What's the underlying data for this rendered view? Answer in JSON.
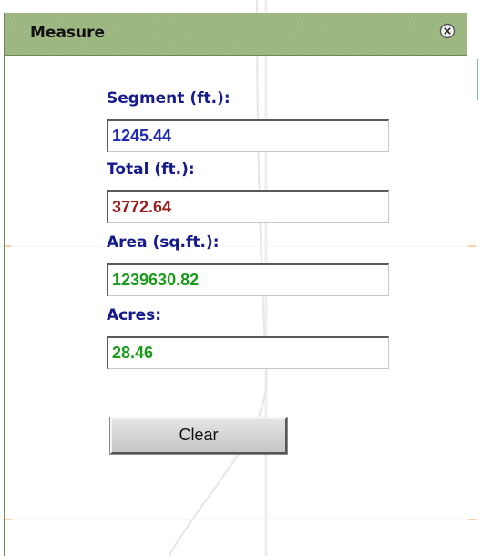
{
  "window": {
    "title": "Measure",
    "close_icon": "close-circle-icon"
  },
  "fields": {
    "segment": {
      "label": "Segment (ft.):",
      "value": "1245.44",
      "color": "#1f2bb0"
    },
    "total": {
      "label": "Total (ft.):",
      "value": "3772.64",
      "color": "#9a1a1a"
    },
    "area": {
      "label": "Area (sq.ft.):",
      "value": "1239630.82",
      "color": "#1a9a1a"
    },
    "acres": {
      "label": "Acres:",
      "value": "28.46",
      "color": "#1a9a1a"
    }
  },
  "actions": {
    "clear_label": "Clear"
  },
  "colors": {
    "title_bar": "#9bb57e",
    "label": "#151a8c"
  }
}
